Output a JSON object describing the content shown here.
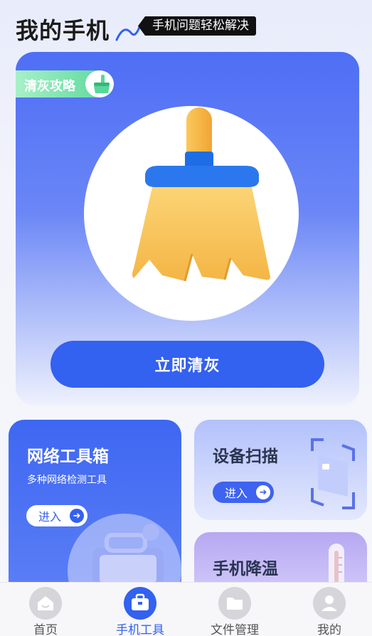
{
  "header": {
    "title": "我的手机",
    "slogan": "手机问题轻松解决"
  },
  "hero": {
    "tag": "清灰攻略",
    "button": "立即清灰"
  },
  "cards": {
    "network": {
      "title": "网络工具箱",
      "desc": "多种网络检测工具",
      "enter": "进入"
    },
    "scan": {
      "title": "设备扫描",
      "enter": "进入"
    },
    "cool": {
      "title": "手机降温"
    }
  },
  "tabs": [
    {
      "label": "首页",
      "icon": "home-icon",
      "active": false
    },
    {
      "label": "手机工具",
      "icon": "toolbox-icon",
      "active": true
    },
    {
      "label": "文件管理",
      "icon": "folder-icon",
      "active": false
    },
    {
      "label": "我的",
      "icon": "user-icon",
      "active": false
    }
  ],
  "colors": {
    "accent": "#3361f0",
    "tag_green": "#58d79a",
    "broom_handle": "#f6b53c",
    "broom_band": "#1e6de6"
  }
}
